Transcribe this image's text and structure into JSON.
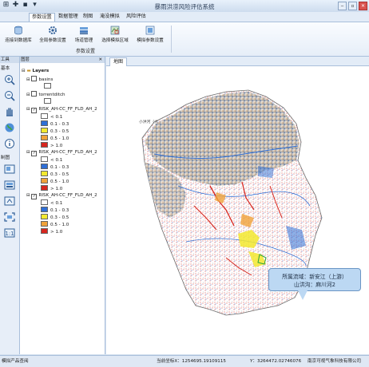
{
  "window": {
    "title": "暴雨洪涝风险评估系统"
  },
  "menu": [
    {
      "label": "参数设置",
      "active": true
    },
    {
      "label": "数据管理",
      "active": false
    },
    {
      "label": "制图",
      "active": false
    },
    {
      "label": "淹没模拟",
      "active": false
    },
    {
      "label": "风险评估",
      "active": false
    }
  ],
  "ribbon": {
    "buttons": [
      "连接到数据库",
      "全局参数设置",
      "场道管理",
      "选择模拟区域",
      "模拟参数设置"
    ],
    "group_label": "参数设置"
  },
  "tools_panel": {
    "title": "工具",
    "basic_label": "基本",
    "mapping_label": "制图"
  },
  "layers_panel": {
    "title": "图层",
    "root_label": "Layers"
  },
  "layers": {
    "basins": "basins",
    "torrentditch": "torrentditch",
    "risk1": {
      "name": "RISK_AH-CC_FF_FLD_AH_2",
      "legend": [
        "< 0.1",
        "0.1 - 0.3",
        "0.3 - 0.5",
        "0.5 - 1.0",
        "> 1.0"
      ]
    },
    "risk2": {
      "name": "RISK_AH-CC_FF_FLD_AH_2",
      "legend": [
        "< 0.1",
        "0.1 - 0.3",
        "0.3 - 0.5",
        "0.5 - 1.0",
        "> 1.0"
      ]
    },
    "risk3": {
      "name": "RISK_AH-CC_FF_FLD_AH_2",
      "legend": [
        "< 0.1",
        "0.1 - 0.3",
        "0.3 - 0.5",
        "0.5 - 1.0",
        "> 1.0"
      ]
    }
  },
  "colors": {
    "class1": "#ffffff",
    "class2": "#2f6fd6",
    "class3": "#f3e92f",
    "class4": "#f0a23a",
    "class5": "#d7261e",
    "ribbon_accent": "#4a7fc0"
  },
  "map": {
    "tab": "地图",
    "label": "小洪河（大",
    "callout_line1": "所属流域：新安江（上游）",
    "callout_line2": "山洪沟：麻川河2"
  },
  "status": {
    "left": "模拟产品查阅",
    "x": "当前坐标X：1254695.19109115",
    "y": "Y：3264472.02746076",
    "company": "南京可视气象科技有限公司"
  }
}
